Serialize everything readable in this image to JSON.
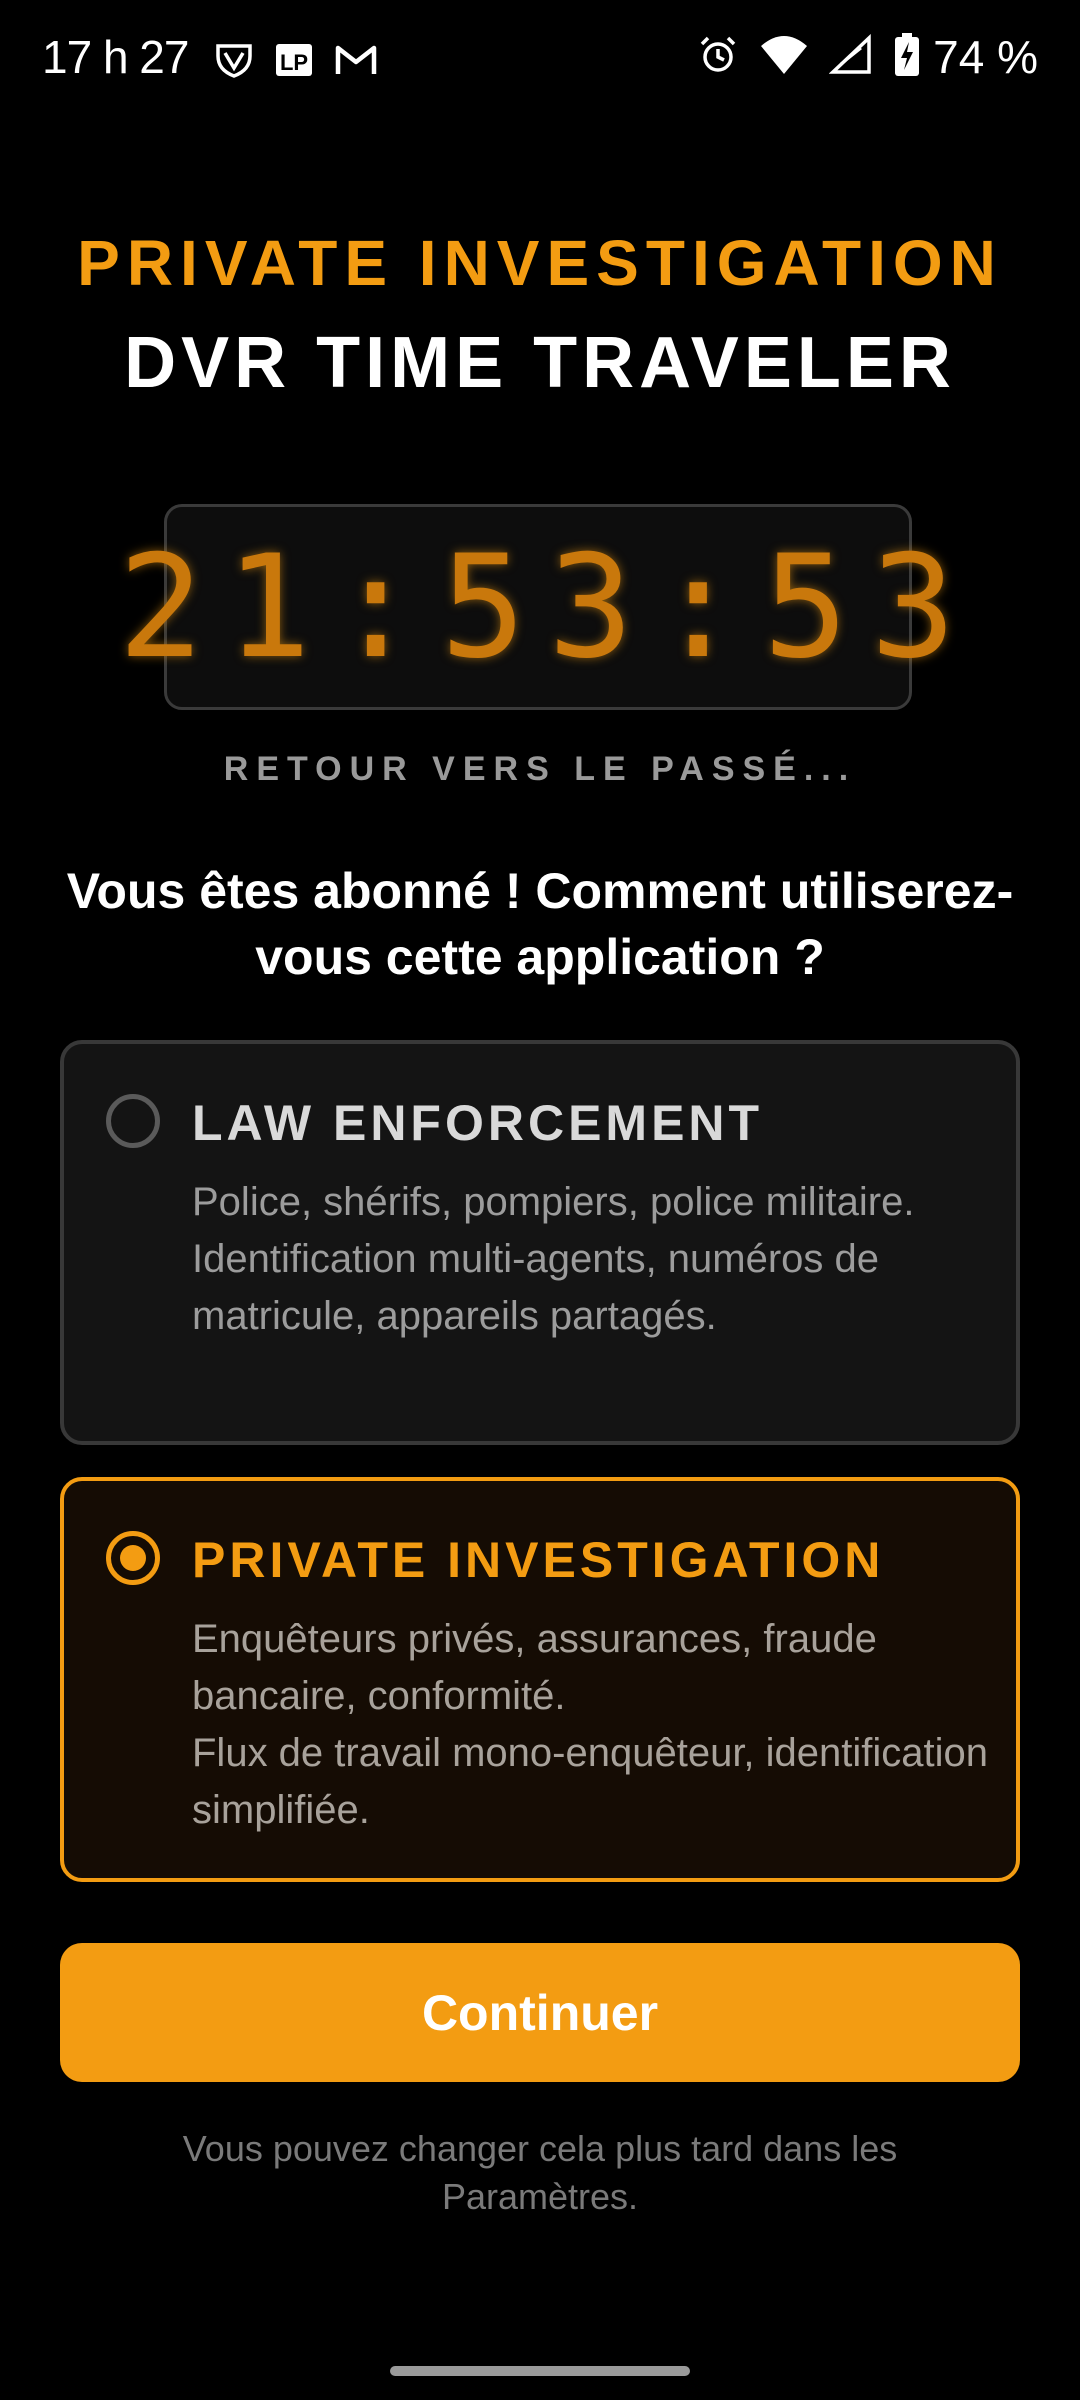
{
  "status_bar": {
    "time": "17 h 27",
    "battery_percent": "74 %",
    "left_icons": [
      "vpn-shield-icon",
      "lp-app-icon",
      "gmail-icon"
    ],
    "right_icons": [
      "alarm-icon",
      "wifi-icon",
      "cell-signal-icon",
      "battery-charging-icon"
    ]
  },
  "header": {
    "subtitle": "PRIVATE INVESTIGATION",
    "title": "DVR TIME TRAVELER"
  },
  "clock": {
    "display": "21:53:53",
    "caption": "RETOUR VERS LE PASSÉ..."
  },
  "question": "Vous êtes abonné ! Comment utiliserez-vous cette application ?",
  "options": [
    {
      "title": "LAW ENFORCEMENT",
      "desc_line1": "Police, shérifs, pompiers, police militaire.",
      "desc_line2": "Identification multi-agents, numéros de matricule, appareils partagés.",
      "selected": false
    },
    {
      "title": "PRIVATE INVESTIGATION",
      "desc_line1": "Enquêteurs privés, assurances, fraude bancaire, conformité.",
      "desc_line2": "Flux de travail mono-enquêteur, identification simplifiée.",
      "selected": true
    }
  ],
  "continue_label": "Continuer",
  "footer_note": "Vous pouvez changer cela plus tard dans les Paramètres.",
  "colors": {
    "accent": "#F39C12",
    "background": "#000000",
    "card_unselected": "#141414",
    "card_selected": "#150C04"
  }
}
